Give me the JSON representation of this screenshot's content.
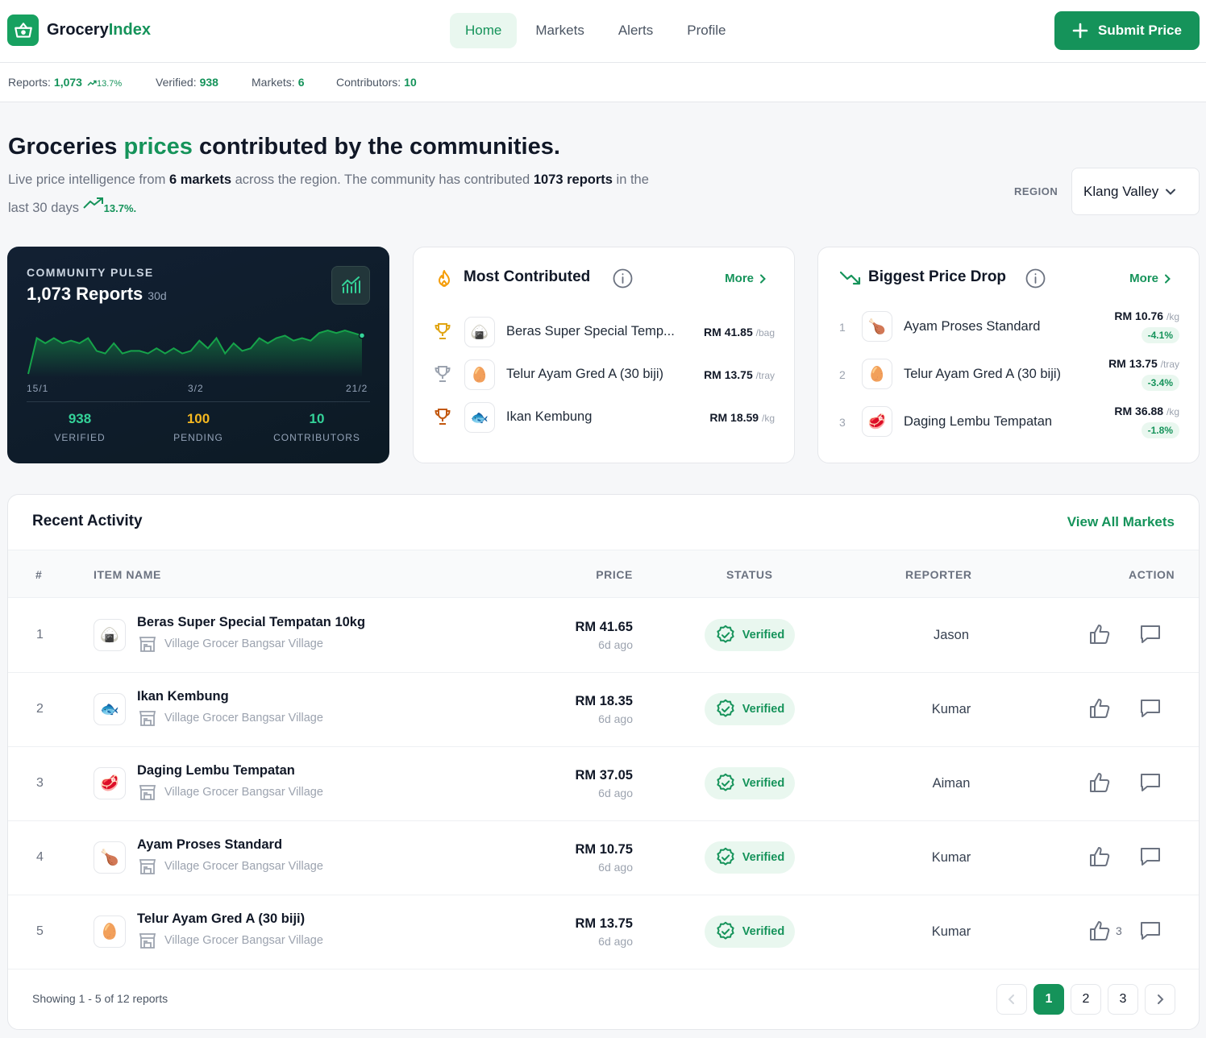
{
  "app": {
    "logo_icon": "basket-icon",
    "name_part1": "Grocery",
    "name_part2": "Index",
    "brand_color": "#15935a"
  },
  "nav": {
    "items": [
      {
        "label": "Home",
        "active": true
      },
      {
        "label": "Markets",
        "active": false
      },
      {
        "label": "Alerts",
        "active": false
      },
      {
        "label": "Profile",
        "active": false
      }
    ],
    "submit_label": "Submit Price"
  },
  "stats": {
    "reports_label": "Reports:",
    "reports_value": "1,073",
    "reports_trend": "13.7%",
    "verified_label": "Verified:",
    "verified_value": "938",
    "markets_label": "Markets:",
    "markets_value": "6",
    "contributors_label": "Contributors:",
    "contributors_value": "10"
  },
  "hero": {
    "title_part1": "Groceries ",
    "title_highlight": "prices",
    "title_part2": " contributed by the communities.",
    "sub_part1": "Live price intelligence from ",
    "sub_markets": "6 markets",
    "sub_part2": " across the region. The community has contributed ",
    "sub_reports": "1073 reports",
    "sub_part3": " in the last 30 days ",
    "sub_trend": "13.7%.",
    "region_label": "REGION",
    "region_value": "Klang Valley"
  },
  "pulse": {
    "label": "COMMUNITY PULSE",
    "total": "1,073 Reports",
    "period": "30d",
    "tick_labels": [
      "15/1",
      "3/2",
      "21/2"
    ],
    "verified_value": "938",
    "verified_label": "VERIFIED",
    "verified_color": "#34d399",
    "pending_value": "100",
    "pending_label": "PENDING",
    "pending_color": "#f5b820",
    "contributors_value": "10",
    "contributors_label": "CONTRIBUTORS",
    "contributors_color": "#34d399"
  },
  "chart_data": {
    "type": "area",
    "title": "",
    "xlabel": "",
    "ylabel": "",
    "x_tick_labels": [
      "15/1",
      "3/2",
      "21/2"
    ],
    "values": [
      0,
      14,
      12,
      14,
      12,
      13,
      12,
      14,
      9,
      8,
      12,
      8,
      9,
      9,
      8,
      10,
      8,
      10,
      8,
      9,
      13,
      10,
      14,
      8,
      12,
      9,
      10,
      14,
      12,
      14,
      15,
      13,
      14,
      13,
      16,
      17,
      16,
      17,
      16,
      15
    ],
    "grid": false,
    "legend": "none"
  },
  "most_contributed": {
    "title": "Most Contributed",
    "more": "More",
    "items": [
      {
        "name": "Beras Super Special Temp...",
        "price": "RM 41.85",
        "unit": "/bag",
        "emoji": "🍙",
        "trophy_color": "#e0a412"
      },
      {
        "name": "Telur Ayam Gred A (30 biji)",
        "price": "RM 13.75",
        "unit": "/tray",
        "emoji": "🥚",
        "trophy_color": "#9ca3af"
      },
      {
        "name": "Ikan Kembung",
        "price": "RM 18.59",
        "unit": "/kg",
        "emoji": "🐟",
        "trophy_color": "#c2580f"
      }
    ]
  },
  "price_drop": {
    "title": "Biggest Price Drop",
    "more": "More",
    "items": [
      {
        "rank": "1",
        "name": "Ayam Proses Standard",
        "price": "RM 10.76",
        "unit": "/kg",
        "change": "-4.1%",
        "emoji": "🍗"
      },
      {
        "rank": "2",
        "name": "Telur Ayam Gred A (30 biji)",
        "price": "RM 13.75",
        "unit": "/tray",
        "change": "-3.4%",
        "emoji": "🥚"
      },
      {
        "rank": "3",
        "name": "Daging Lembu Tempatan",
        "price": "RM 36.88",
        "unit": "/kg",
        "change": "-1.8%",
        "emoji": "🥩"
      }
    ]
  },
  "activity": {
    "title": "Recent Activity",
    "view_all": "View All Markets",
    "columns": [
      "#",
      "ITEM NAME",
      "PRICE",
      "STATUS",
      "REPORTER",
      "ACTION"
    ],
    "rows": [
      {
        "idx": "1",
        "name": "Beras Super Special Tempatan 10kg",
        "market": "Village Grocer Bangsar Village",
        "price": "RM 41.65",
        "ago": "6d ago",
        "status": "Verified",
        "reporter": "Jason",
        "likes": "",
        "emoji": "🍙"
      },
      {
        "idx": "2",
        "name": "Ikan Kembung",
        "market": "Village Grocer Bangsar Village",
        "price": "RM 18.35",
        "ago": "6d ago",
        "status": "Verified",
        "reporter": "Kumar",
        "likes": "",
        "emoji": "🐟"
      },
      {
        "idx": "3",
        "name": "Daging Lembu Tempatan",
        "market": "Village Grocer Bangsar Village",
        "price": "RM 37.05",
        "ago": "6d ago",
        "status": "Verified",
        "reporter": "Aiman",
        "likes": "",
        "emoji": "🥩"
      },
      {
        "idx": "4",
        "name": "Ayam Proses Standard",
        "market": "Village Grocer Bangsar Village",
        "price": "RM 10.75",
        "ago": "6d ago",
        "status": "Verified",
        "reporter": "Kumar",
        "likes": "",
        "emoji": "🍗"
      },
      {
        "idx": "5",
        "name": "Telur Ayam Gred A (30 biji)",
        "market": "Village Grocer Bangsar Village",
        "price": "RM 13.75",
        "ago": "6d ago",
        "status": "Verified",
        "reporter": "Kumar",
        "likes": "3",
        "emoji": "🥚"
      }
    ],
    "showing": "Showing 1 - 5 of 12 reports",
    "pages": [
      "1",
      "2",
      "3"
    ],
    "current_page": "1"
  }
}
